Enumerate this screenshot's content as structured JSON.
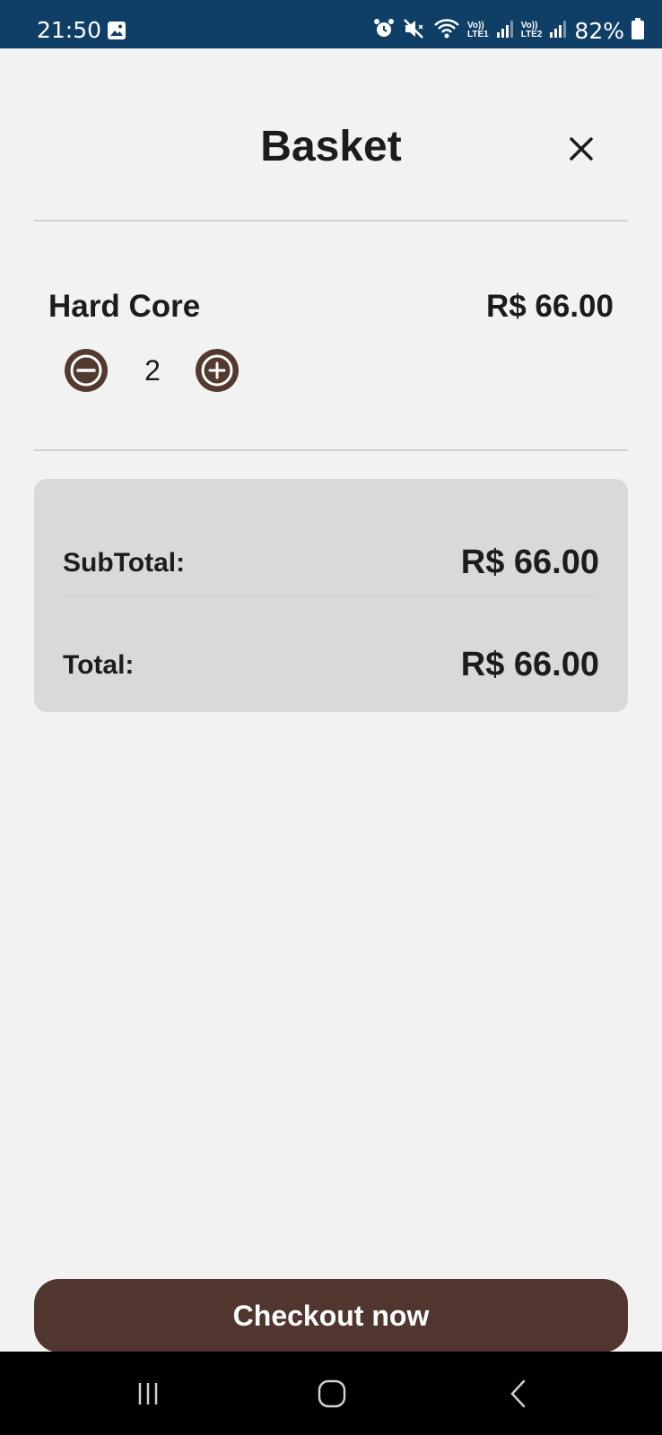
{
  "status_bar": {
    "time": "21:50",
    "battery": "82%",
    "sim1": {
      "top": "Vo))",
      "bottom": "LTE1"
    },
    "sim2": {
      "top": "Vo))",
      "bottom": "LTE2"
    }
  },
  "header": {
    "title": "Basket",
    "close_icon": "close-icon"
  },
  "items": [
    {
      "name": "Hard Core",
      "price": "R$ 66.00",
      "quantity": "2"
    }
  ],
  "summary": {
    "subtotal_label": "SubTotal:",
    "subtotal_value": "R$ 66.00",
    "total_label": "Total:",
    "total_value": "R$ 66.00"
  },
  "checkout": {
    "label": "Checkout now"
  },
  "colors": {
    "status_bar": "#0f3e66",
    "accent_brown": "#51362f",
    "background": "#f2f2f2",
    "summary_card": "#d9d9d9"
  }
}
